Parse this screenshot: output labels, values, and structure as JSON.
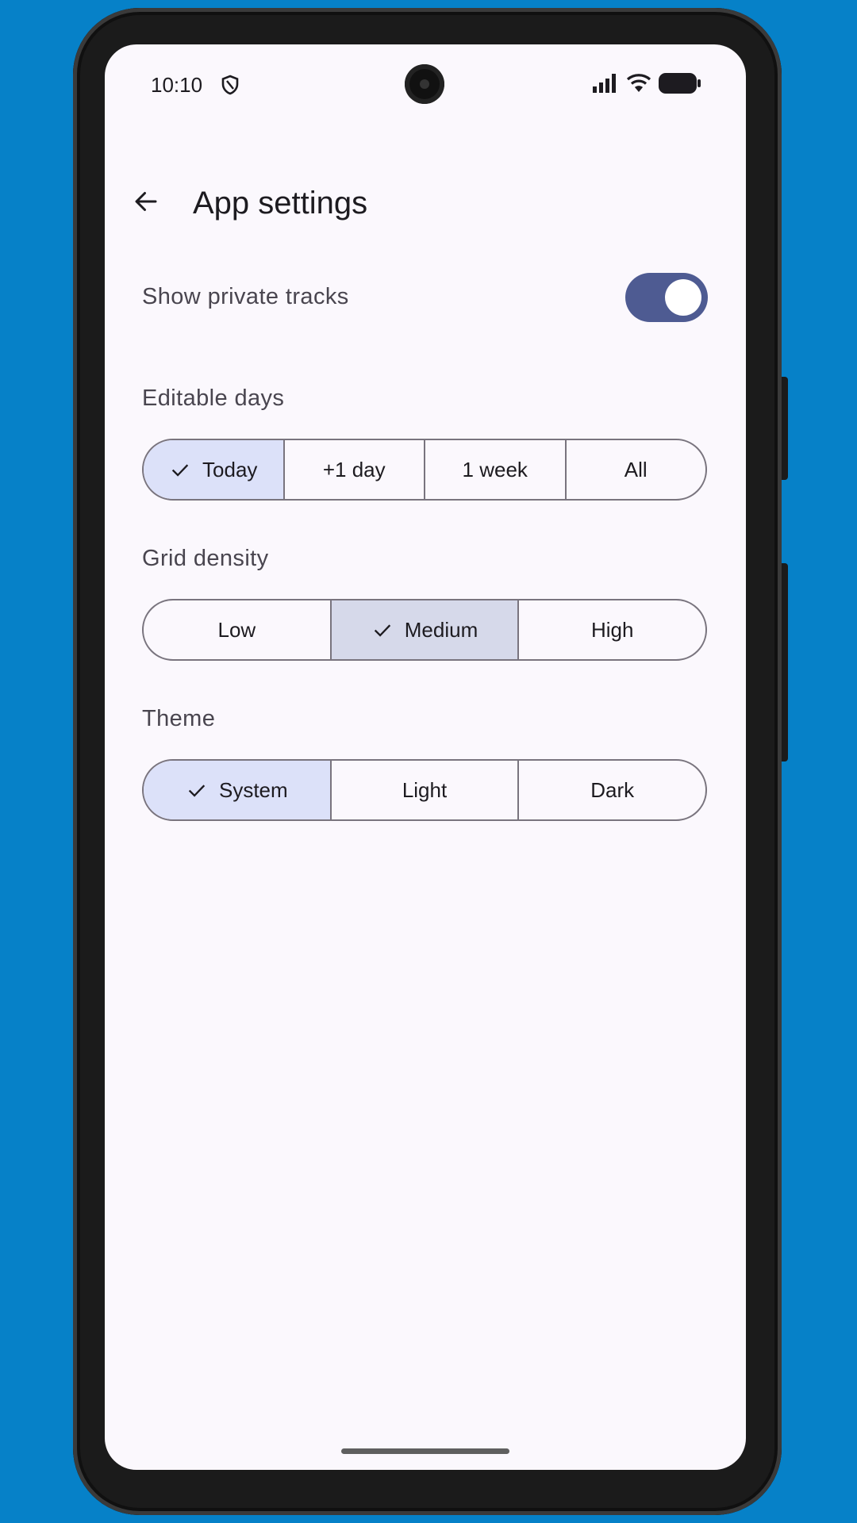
{
  "status_bar": {
    "time": "10:10",
    "icons": [
      "shield-icon",
      "cellular-signal-icon",
      "wifi-icon",
      "battery-icon"
    ]
  },
  "app_bar": {
    "back_icon": "arrow-back-icon",
    "title": "App settings"
  },
  "settings": {
    "private_tracks": {
      "label": "Show private tracks",
      "enabled": true
    },
    "editable_days": {
      "label": "Editable days",
      "options": [
        "Today",
        "+1 day",
        "1 week",
        "All"
      ],
      "selected": "Today"
    },
    "grid_density": {
      "label": "Grid density",
      "options": [
        "Low",
        "Medium",
        "High"
      ],
      "selected": "Medium"
    },
    "theme": {
      "label": "Theme",
      "options": [
        "System",
        "Light",
        "Dark"
      ],
      "selected": "System"
    }
  },
  "colors": {
    "background": "#0681c8",
    "surface": "#fbf8fd",
    "switch_track": "#4e5b92",
    "selected_segment": "#dce1f9",
    "outline": "#79747e"
  }
}
